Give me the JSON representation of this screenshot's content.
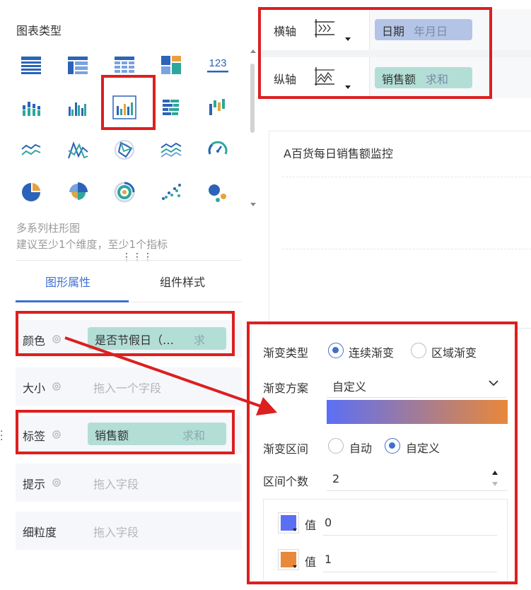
{
  "left_panel": {
    "title": "图表类型",
    "chart_types": [
      {
        "icon": "table-icon"
      },
      {
        "icon": "cross-table-icon"
      },
      {
        "icon": "detail-table-icon"
      },
      {
        "icon": "card-block-icon"
      },
      {
        "icon": "number-card-icon",
        "text": "123"
      },
      {
        "icon": "stacked-column-icon"
      },
      {
        "icon": "grouped-column-icon"
      },
      {
        "icon": "multi-series-column-icon",
        "selected": true
      },
      {
        "icon": "stacked-bar-icon"
      },
      {
        "icon": "waterfall-icon"
      },
      {
        "icon": "line-icon"
      },
      {
        "icon": "area-line-icon"
      },
      {
        "icon": "radar-icon"
      },
      {
        "icon": "stacked-area-icon"
      },
      {
        "icon": "gauge-icon"
      },
      {
        "icon": "pie-icon"
      },
      {
        "icon": "rose-pie-icon"
      },
      {
        "icon": "ring-icon"
      },
      {
        "icon": "scatter-icon"
      },
      {
        "icon": "bubble-icon"
      }
    ],
    "chart_name": "多系列柱形图",
    "chart_hint": "建议至少1个维度，至少1个指标",
    "tabs": [
      "图形属性",
      "组件样式"
    ],
    "properties": {
      "color": {
        "label": "颜色",
        "field": "是否节假日（…",
        "agg": "求"
      },
      "size": {
        "label": "大小",
        "placeholder": "拖入一个字段"
      },
      "tag": {
        "label": "标签",
        "field": "销售额",
        "agg": "求和"
      },
      "tooltip": {
        "label": "提示",
        "placeholder": "拖入字段"
      },
      "granularity": {
        "label": "细粒度",
        "placeholder": "拖入字段"
      }
    }
  },
  "axes": {
    "x": {
      "label": "横轴",
      "field": "日期",
      "agg": "年月日"
    },
    "y": {
      "label": "纵轴",
      "field": "销售额",
      "agg": "求和"
    }
  },
  "canvas": {
    "title": "A百货每日销售额监控"
  },
  "gradient_popup": {
    "type_label": "渐变类型",
    "type_options": [
      "连续渐变",
      "区域渐变"
    ],
    "scheme_label": "渐变方案",
    "scheme_value": "自定义",
    "range_label": "渐变区间",
    "range_options": [
      "自动",
      "自定义"
    ],
    "count_label": "区间个数",
    "count_value": "2",
    "stops": [
      {
        "label": "值",
        "value": "0",
        "color": "#5b6ff5"
      },
      {
        "label": "值",
        "value": "1",
        "color": "#e8883a"
      }
    ]
  },
  "colors": {
    "accent": "#3f6fd2",
    "dim_pill": "#b4c4e6",
    "measure_pill": "#b3ded6",
    "annotation_red": "#dd1f1f",
    "icon_blue": "#2c63b8",
    "icon_teal": "#2ea79a",
    "icon_orange": "#e8a23a"
  }
}
